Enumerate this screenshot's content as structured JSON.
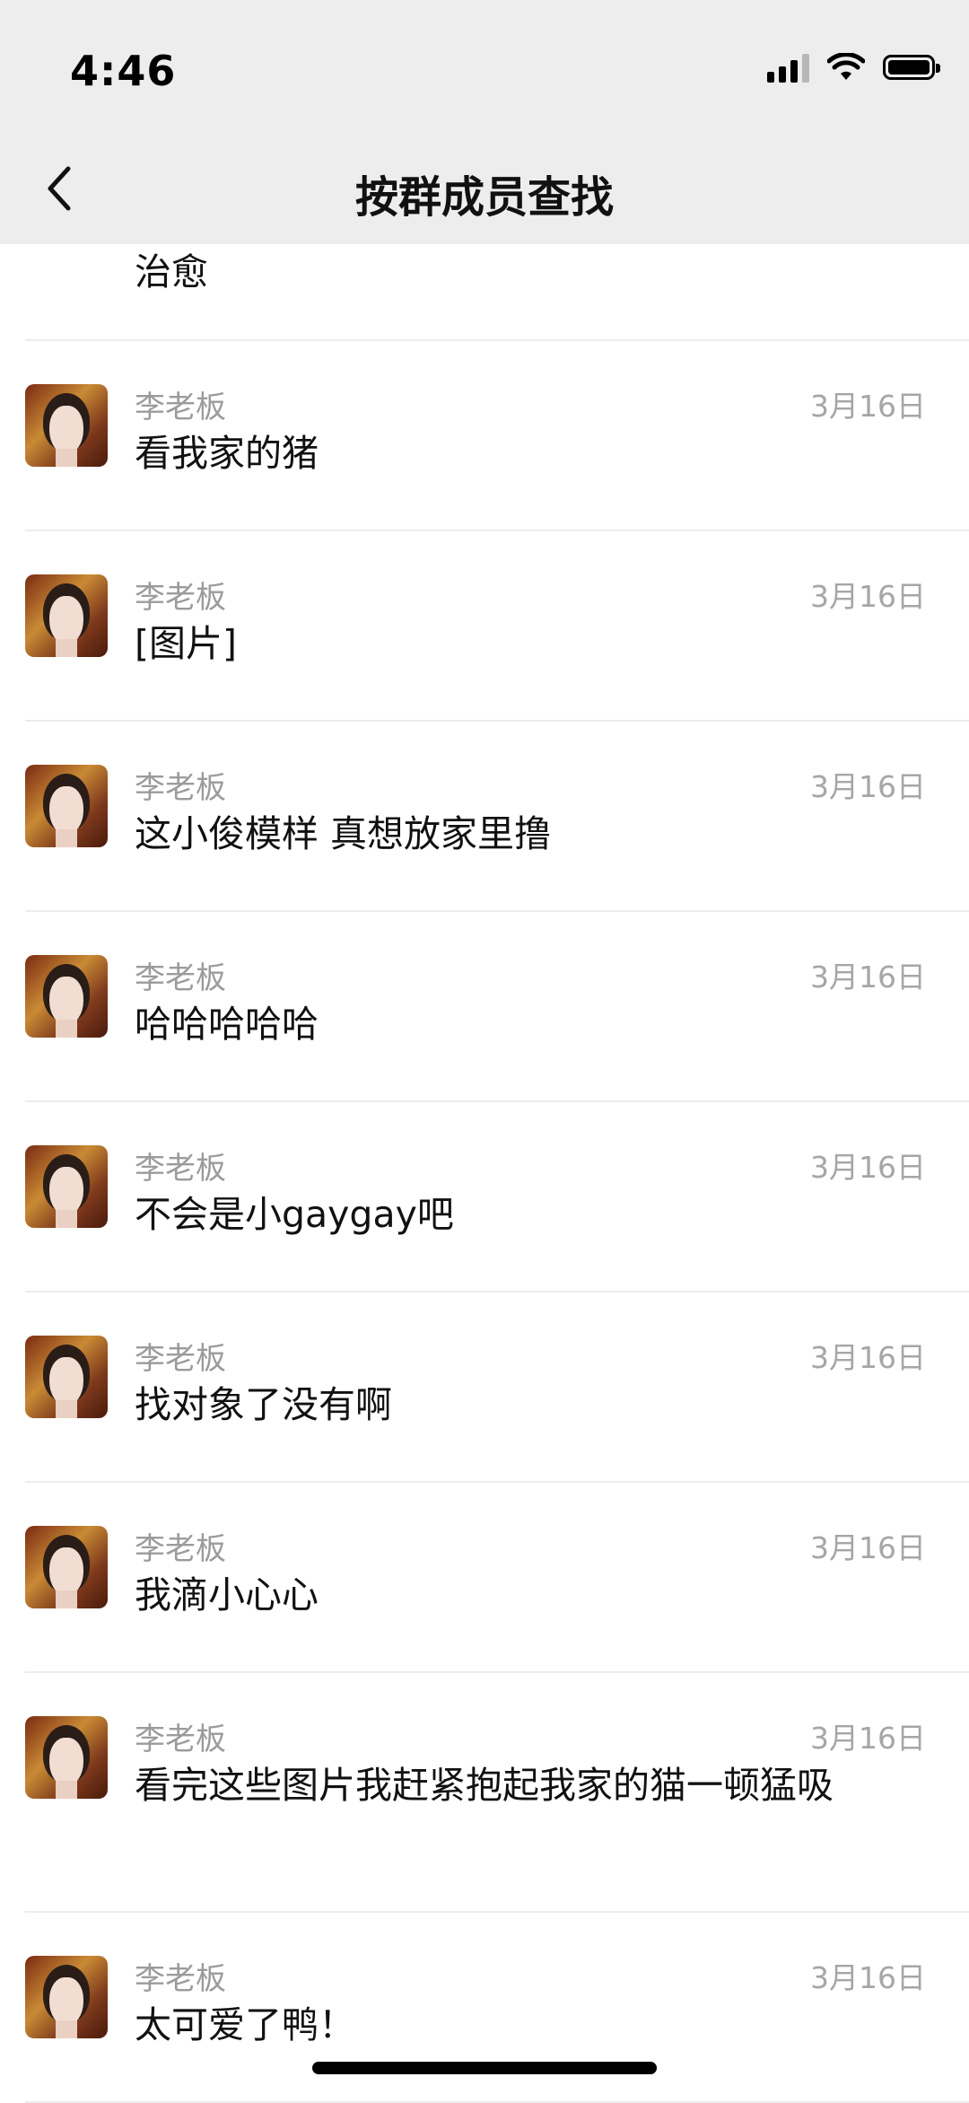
{
  "status": {
    "time": "4:46"
  },
  "nav": {
    "title": "按群成员查找"
  },
  "first_item": {
    "content": "治愈"
  },
  "items": [
    {
      "sender": "李老板",
      "date": "3月16日",
      "content": "看我家的猪"
    },
    {
      "sender": "李老板",
      "date": "3月16日",
      "content": "[图片]"
    },
    {
      "sender": "李老板",
      "date": "3月16日",
      "content": "这小俊模样 真想放家里撸"
    },
    {
      "sender": "李老板",
      "date": "3月16日",
      "content": "哈哈哈哈哈"
    },
    {
      "sender": "李老板",
      "date": "3月16日",
      "content": "不会是小gaygay吧"
    },
    {
      "sender": "李老板",
      "date": "3月16日",
      "content": "找对象了没有啊"
    },
    {
      "sender": "李老板",
      "date": "3月16日",
      "content": "我滴小心心"
    },
    {
      "sender": "李老板",
      "date": "3月16日",
      "content": "看完这些图片我赶紧抱起我家的猫一顿猛吸"
    },
    {
      "sender": "李老板",
      "date": "3月16日",
      "content": "太可爱了鸭！"
    }
  ]
}
